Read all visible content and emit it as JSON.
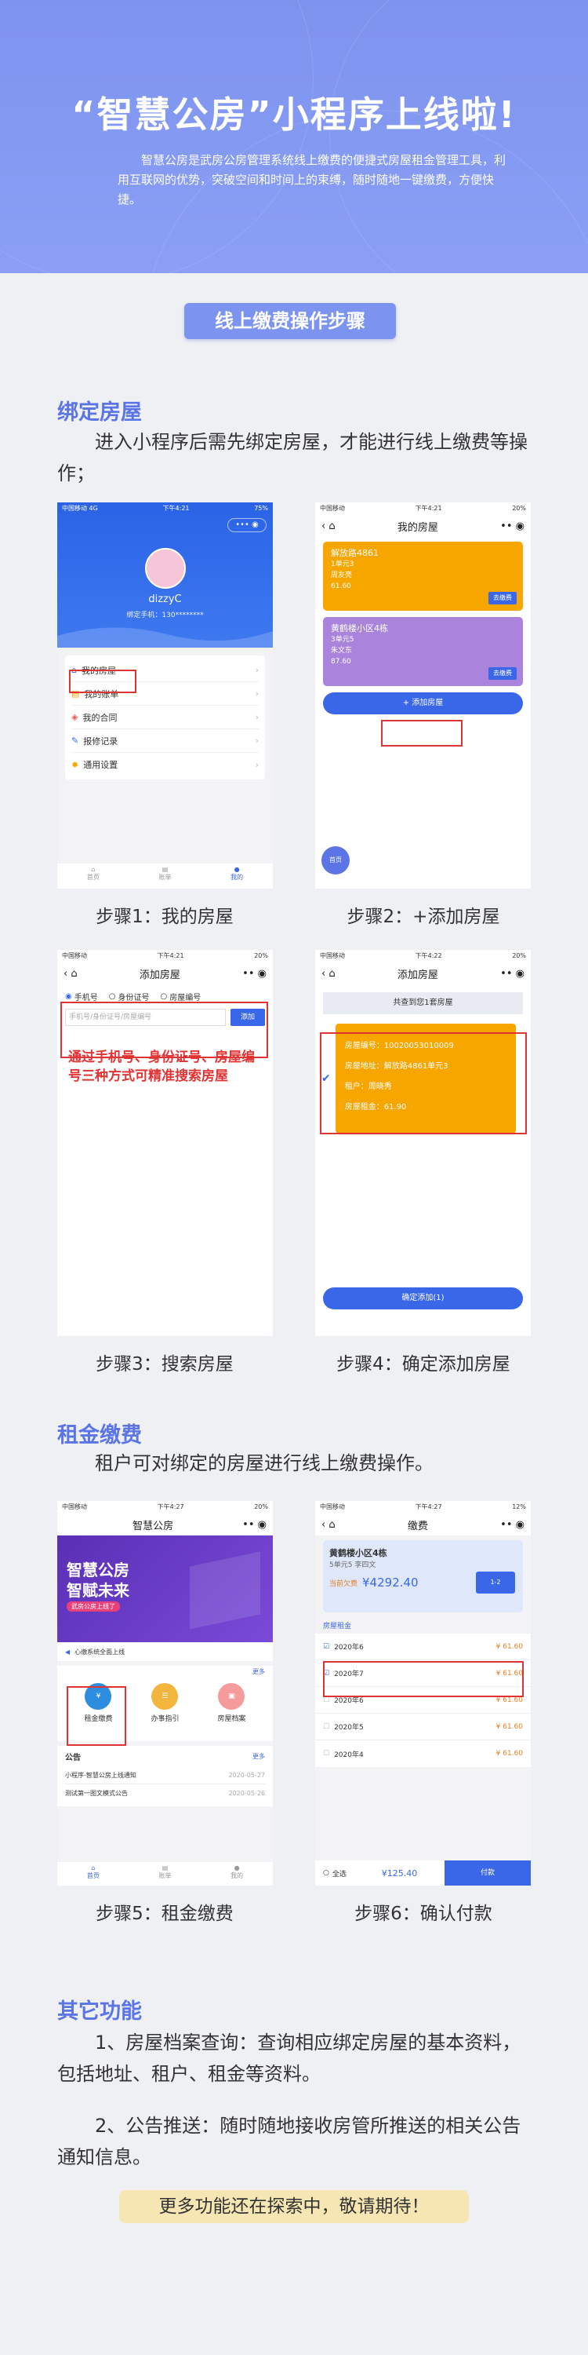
{
  "hero": {
    "title": "“智慧公房”小程序上线啦!",
    "desc": "智慧公房是武房公房管理系统线上缴费的便捷式房屋租金管理工具，利用互联网的优势，突破空间和时间上的束缚，随时随地一键缴费，方便快捷。"
  },
  "steps_title": "线上缴费操作步骤",
  "bind": {
    "heading": "绑定房屋",
    "text": "进入小程序后需先绑定房屋，才能进行线上缴费等操作；",
    "captions": [
      "步骤1：我的房屋",
      "步骤2：+添加房屋",
      "步骤3：搜索房屋",
      "步骤4：确定添加房屋"
    ]
  },
  "rent": {
    "heading": "租金缴费",
    "text": "租户可对绑定的房屋进行线上缴费操作。",
    "captions": [
      "步骤5：租金缴费",
      "步骤6：确认付款"
    ]
  },
  "other": {
    "heading": "其它功能",
    "item1": "1、房屋档案查询：查询相应绑定房屋的基本资料，包括地址、租户、租金等资料。",
    "item2": "2、公告推送：随时随地接收房管所推送的相关公告通知信息。"
  },
  "footer": "更多功能还在探索中，敬请期待！",
  "screens": {
    "s1": {
      "status_left": "中国移动 4G",
      "status_time": "下午4:21",
      "status_right": "75%",
      "username": "dizzyC",
      "phone": "绑定手机：130********",
      "menu": [
        "我的房屋",
        "我的账单",
        "我的合同",
        "报修记录",
        "通用设置"
      ],
      "tabs": [
        "首页",
        "账单",
        "我的"
      ]
    },
    "s2": {
      "status_left": "中国移动",
      "status_time": "下午4:21",
      "status_right": "20%",
      "title": "我的房屋",
      "card1": {
        "name": "解放路4861",
        "l1": "1单元3",
        "l2": "周友亮",
        "l3": "61.60",
        "btn": "去缴费"
      },
      "card2": {
        "name": "黄鹤楼小区4栋",
        "l1": "3单元5",
        "l2": "朱文东",
        "l3": "87.60",
        "btn": "去缴费"
      },
      "add": "+ 添加房屋",
      "float": "首页"
    },
    "s3": {
      "status_left": "中国移动",
      "status_time": "下午4:21",
      "status_right": "20%",
      "title": "添加房屋",
      "options": [
        "手机号",
        "身份证号",
        "房屋编号"
      ],
      "placeholder": "手机号/身份证号/房屋编号",
      "btn": "添加",
      "note": "通过手机号、身份证号、房屋编号三种方式可精准搜索房屋"
    },
    "s4": {
      "status_left": "中国移动",
      "status_time": "下午4:22",
      "status_right": "20%",
      "title": "添加房屋",
      "found": "共查到您1套房屋",
      "fields": [
        [
          "房屋编号：",
          "10020053010009"
        ],
        [
          "房屋地址：",
          "解放路4861单元3"
        ],
        [
          "租户：",
          "周晓秀"
        ],
        [
          "房屋租金：",
          "61.90"
        ]
      ],
      "btn": "确定添加(1)"
    },
    "s5": {
      "status_left": "中国移动",
      "status_time": "下午4:27",
      "status_right": "20%",
      "title": "智慧公房",
      "banner1": "智慧公房",
      "banner2": "智赋未来",
      "banner3": "武房公房上线了",
      "notice": "心缴系统全面上线",
      "more": "更多",
      "icons": [
        "租金缴费",
        "办事指引",
        "房屋档案"
      ],
      "announce_title": "公告",
      "announce": [
        [
          "小程序-智慧公房上线通知",
          "2020-05-27"
        ],
        [
          "测试第一图文模式公告",
          "2020-05-26"
        ]
      ],
      "tabs": [
        "首页",
        "账单",
        "我的"
      ]
    },
    "s6": {
      "status_left": "中国移动",
      "status_time": "下午4:27",
      "status_right": "12%",
      "title": "缴费",
      "house": "黄鹤楼小区4栋",
      "house_sub": "5单元5 李四文",
      "balance_label": "当前欠费",
      "balance": "¥4292.40",
      "card_tip": "1-2",
      "section": "房屋租金",
      "rows": [
        [
          "2020年6",
          "¥ 61.60"
        ],
        [
          "2020年7",
          "¥ 61.60"
        ],
        [
          "2020年6",
          "¥ 61.60"
        ],
        [
          "2020年5",
          "¥ 61.60"
        ],
        [
          "2020年4",
          "¥ 61.60"
        ]
      ],
      "all": "全选",
      "total": "¥125.40",
      "pay": "付款"
    }
  },
  "colors": {
    "accent": "#7c93ef",
    "title_blue": "#5b74e6",
    "orange": "#f7a600",
    "purple": "#a983dc",
    "red": "#e03333"
  }
}
